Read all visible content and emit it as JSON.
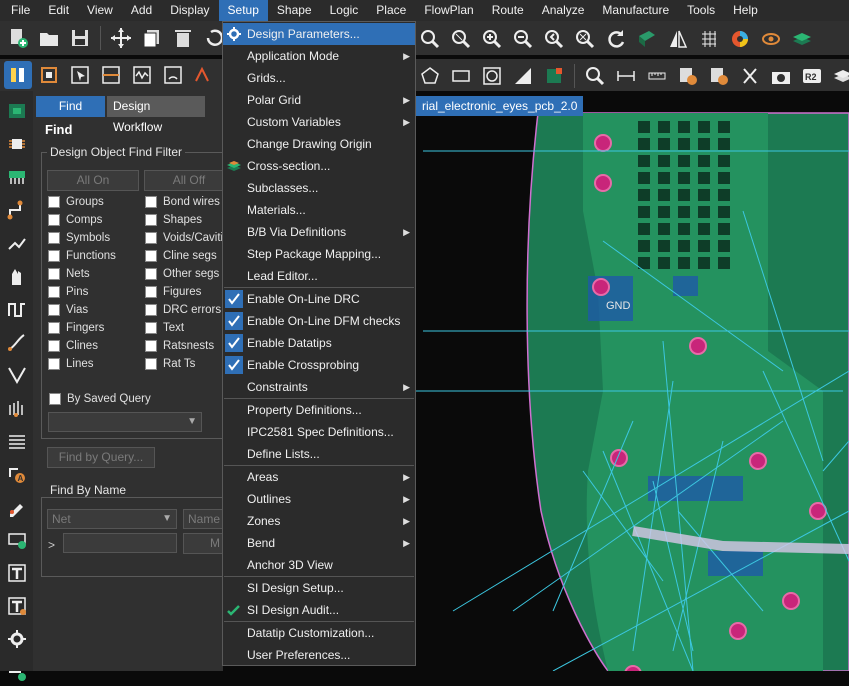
{
  "menubar": {
    "items": [
      "File",
      "Edit",
      "View",
      "Add",
      "Display",
      "Setup",
      "Shape",
      "Logic",
      "Place",
      "FlowPlan",
      "Route",
      "Analyze",
      "Manufacture",
      "Tools",
      "Help"
    ],
    "active": "Setup"
  },
  "panel": {
    "tabs": [
      "Find",
      "Design Workflow"
    ],
    "title": "Find",
    "filter_group": "Design Object Find Filter",
    "all_on": "All On",
    "all_off": "All Off",
    "left_items": [
      "Groups",
      "Comps",
      "Symbols",
      "Functions",
      "Nets",
      "Pins",
      "Vias",
      "Fingers",
      "Clines",
      "Lines"
    ],
    "right_items": [
      "Bond wires",
      "Shapes",
      "Voids/Cavities",
      "Cline segs",
      "Other segs",
      "Figures",
      "DRC errors",
      "Text",
      "Ratsnests",
      "Rat Ts"
    ],
    "saved_query": "By Saved Query",
    "find_by_query": "Find by Query...",
    "find_by_name": "Find By Name",
    "net_combo": "Net",
    "name_combo": "Name",
    "more_btn": "M",
    "name_prompt": ">"
  },
  "document_tab": "rial_electronic_eyes_pcb_2.0",
  "canvas_labels": [
    "GND"
  ],
  "setup_menu": {
    "items": [
      {
        "label": "Design Parameters...",
        "icon": "gear-icon",
        "highlighted": true
      },
      {
        "label": "Application Mode",
        "submenu": true
      },
      {
        "label": "Grids..."
      },
      {
        "label": "Polar Grid",
        "submenu": true
      },
      {
        "label": "Custom Variables",
        "submenu": true
      },
      {
        "label": "Change Drawing Origin"
      },
      {
        "label": "Cross-section...",
        "icon": "layer-stack-icon"
      },
      {
        "label": "Subclasses..."
      },
      {
        "label": "Materials..."
      },
      {
        "label": "B/B Via Definitions",
        "submenu": true
      },
      {
        "label": "Step Package Mapping..."
      },
      {
        "label": "Lead Editor..."
      },
      {
        "separator": true
      },
      {
        "label": "Enable On-Line DRC",
        "checked": true
      },
      {
        "label": "Enable On-Line DFM checks",
        "checked": true
      },
      {
        "label": "Enable Datatips",
        "checked": true,
        "icon": "datatip-icon"
      },
      {
        "label": "Enable Crossprobing",
        "checked": true
      },
      {
        "label": "Constraints",
        "submenu": true
      },
      {
        "separator": true
      },
      {
        "label": "Property Definitions..."
      },
      {
        "label": "IPC2581 Spec Definitions..."
      },
      {
        "label": "Define Lists..."
      },
      {
        "separator": true
      },
      {
        "label": "Areas",
        "submenu": true
      },
      {
        "label": "Outlines",
        "submenu": true
      },
      {
        "label": "Zones",
        "submenu": true
      },
      {
        "label": "Bend",
        "submenu": true
      },
      {
        "label": "Anchor 3D View"
      },
      {
        "separator": true
      },
      {
        "label": "SI Design Setup..."
      },
      {
        "label": "SI Design Audit...",
        "icon": "audit-check-icon"
      },
      {
        "separator": true
      },
      {
        "label": "Datatip Customization..."
      },
      {
        "label": "User Preferences..."
      }
    ]
  },
  "colors": {
    "accent": "#2f6fb6",
    "board_green": "#1c7a52",
    "copper_green": "#2a9a6a",
    "via_magenta": "#c8257a",
    "ratsnest_cyan": "#3cc7e0"
  }
}
